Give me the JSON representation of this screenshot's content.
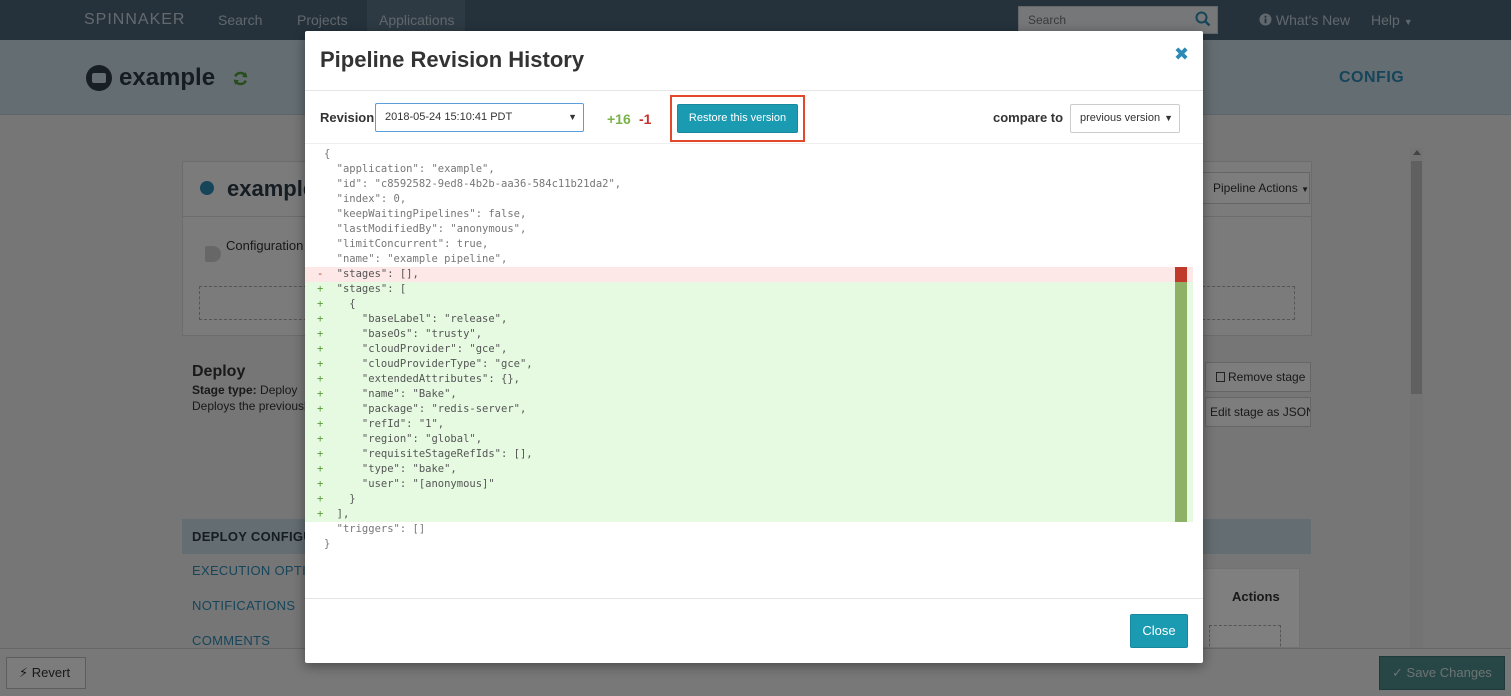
{
  "nav": {
    "brand": "SPINNAKER",
    "links": [
      "Search",
      "Projects",
      "Applications"
    ],
    "search_placeholder": "Search",
    "whats_new": "What's New",
    "help": "Help"
  },
  "app": {
    "name": "example",
    "config_link": "CONFIG"
  },
  "background": {
    "pipeline_name": "example",
    "configuration_label": "Configuration",
    "pipeline_actions": "Pipeline Actions",
    "stage_title": "Deploy",
    "stage_type_label": "Stage type:",
    "stage_type_value": "Deploy",
    "stage_description": "Deploys the previously",
    "remove_stage": "Remove stage",
    "edit_stage_json": "Edit stage as JSON",
    "tab_label": "DEPLOY CONFIGURATION",
    "left_nav": [
      "EXECUTION OPTIONS",
      "NOTIFICATIONS",
      "COMMENTS"
    ],
    "actions_header": "Actions",
    "revert": "Revert",
    "save_changes": "Save Changes"
  },
  "modal": {
    "title": "Pipeline Revision History",
    "revision_label": "Revision",
    "revision_value": "2018-05-24 15:10:41 PDT",
    "additions": "+16",
    "deletions": "-1",
    "restore_button": "Restore this version",
    "compare_label": "compare to",
    "compare_value": "previous version",
    "close_button": "Close"
  },
  "diff_lines": [
    {
      "type": "ctx",
      "marker": "",
      "text": "{"
    },
    {
      "type": "ctx",
      "marker": "",
      "text": "  \"application\": \"example\","
    },
    {
      "type": "ctx",
      "marker": "",
      "text": "  \"id\": \"c8592582-9ed8-4b2b-aa36-584c11b21da2\","
    },
    {
      "type": "ctx",
      "marker": "",
      "text": "  \"index\": 0,"
    },
    {
      "type": "ctx",
      "marker": "",
      "text": "  \"keepWaitingPipelines\": false,"
    },
    {
      "type": "ctx",
      "marker": "",
      "text": "  \"lastModifiedBy\": \"anonymous\","
    },
    {
      "type": "ctx",
      "marker": "",
      "text": "  \"limitConcurrent\": true,"
    },
    {
      "type": "ctx",
      "marker": "",
      "text": "  \"name\": \"example pipeline\","
    },
    {
      "type": "rem",
      "marker": "-",
      "text": "  \"stages\": [],"
    },
    {
      "type": "add",
      "marker": "+",
      "text": "  \"stages\": ["
    },
    {
      "type": "add",
      "marker": "+",
      "text": "    {"
    },
    {
      "type": "add",
      "marker": "+",
      "text": "      \"baseLabel\": \"release\","
    },
    {
      "type": "add",
      "marker": "+",
      "text": "      \"baseOs\": \"trusty\","
    },
    {
      "type": "add",
      "marker": "+",
      "text": "      \"cloudProvider\": \"gce\","
    },
    {
      "type": "add",
      "marker": "+",
      "text": "      \"cloudProviderType\": \"gce\","
    },
    {
      "type": "add",
      "marker": "+",
      "text": "      \"extendedAttributes\": {},"
    },
    {
      "type": "add",
      "marker": "+",
      "text": "      \"name\": \"Bake\","
    },
    {
      "type": "add",
      "marker": "+",
      "text": "      \"package\": \"redis-server\","
    },
    {
      "type": "add",
      "marker": "+",
      "text": "      \"refId\": \"1\","
    },
    {
      "type": "add",
      "marker": "+",
      "text": "      \"region\": \"global\","
    },
    {
      "type": "add",
      "marker": "+",
      "text": "      \"requisiteStageRefIds\": [],"
    },
    {
      "type": "add",
      "marker": "+",
      "text": "      \"type\": \"bake\","
    },
    {
      "type": "add",
      "marker": "+",
      "text": "      \"user\": \"[anonymous]\""
    },
    {
      "type": "add",
      "marker": "+",
      "text": "    }"
    },
    {
      "type": "add",
      "marker": "+",
      "text": "  ],"
    },
    {
      "type": "ctx",
      "marker": "",
      "text": "  \"triggers\": []"
    },
    {
      "type": "ctx",
      "marker": "",
      "text": "}"
    }
  ],
  "colors": {
    "nav_bg": "#4a6478",
    "accent": "#1a9bb2",
    "added_bg": "#e6fae2",
    "removed_bg": "#fde7e7",
    "highlight": "#e2492a"
  }
}
